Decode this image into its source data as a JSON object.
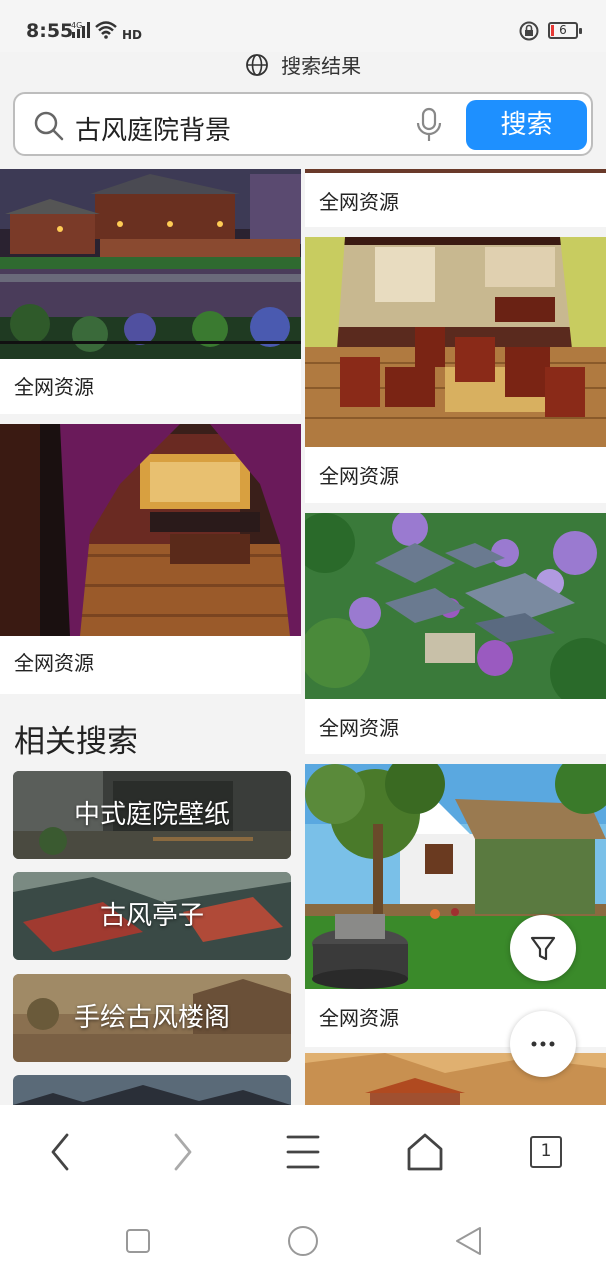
{
  "status": {
    "time": "8:55",
    "network": "4G",
    "hd": "HD",
    "battery": "6"
  },
  "header": {
    "title": "搜索结果"
  },
  "search": {
    "query": "古风庭院背景",
    "button": "搜索"
  },
  "results": {
    "caption": "全网资源",
    "left": [
      {
        "caption": "全网资源",
        "image": "ancient-courtyard-night"
      },
      {
        "caption": "全网资源",
        "image": "chinese-interior-curtains"
      }
    ],
    "right": [
      {
        "caption": "全网资源",
        "image": "partial-top"
      },
      {
        "caption": "全网资源",
        "image": "tea-room-interior"
      },
      {
        "caption": "全网资源",
        "image": "aerial-garden-pavilions"
      },
      {
        "caption": "全网资源",
        "image": "cottage-tree-yard"
      }
    ]
  },
  "related": {
    "title": "相关搜索",
    "items": [
      "中式庭院壁纸",
      "古风亭子",
      "手绘古风楼阁"
    ]
  },
  "fabs": {
    "filter": "filter-icon",
    "more": "more-icon"
  },
  "nav": {
    "tab_count": "1"
  },
  "colors": {
    "accent": "#1e90ff",
    "battery_low": "#e53935"
  }
}
